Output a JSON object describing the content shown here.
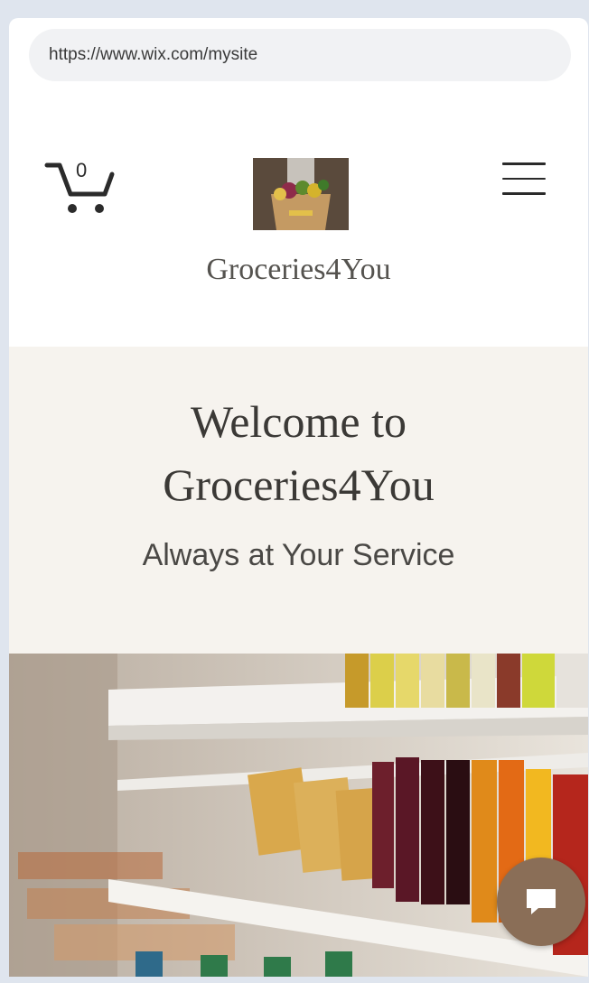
{
  "browser": {
    "url": "https://www.wix.com/mysite"
  },
  "header": {
    "cart_count": "0",
    "site_name": "Groceries4You",
    "logo_alt": "grocery-bag-logo"
  },
  "hero": {
    "title_line1": "Welcome to",
    "title_line2": "Groceries4You",
    "subtitle": "Always at Your Service"
  },
  "image": {
    "description": "supermarket-shelf-photo"
  },
  "colors": {
    "hero_bg": "#f6f3ee",
    "chat_button": "#8a6e57",
    "text_dark": "#3b3936"
  },
  "icons": [
    "cart-icon",
    "menu-icon",
    "chat-icon"
  ]
}
